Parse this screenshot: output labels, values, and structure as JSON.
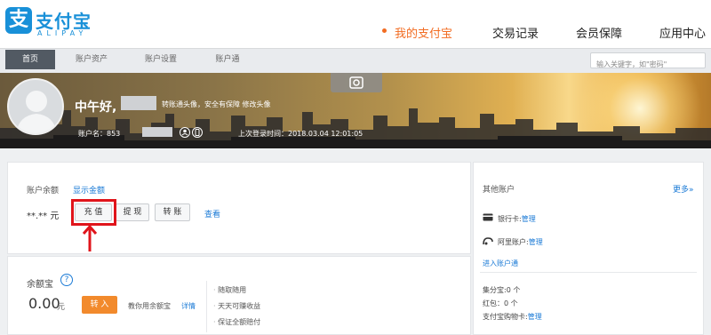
{
  "header": {
    "logo_glyph": "支",
    "logo_cn": "支付宝",
    "logo_en": "ALIPAY",
    "nav": [
      {
        "label": "我的支付宝",
        "active": true
      },
      {
        "label": "交易记录",
        "active": false
      },
      {
        "label": "会员保障",
        "active": false
      },
      {
        "label": "应用中心",
        "active": false
      }
    ],
    "accent_color": "#f26c22",
    "brand_color": "#1890d8"
  },
  "subnav": {
    "tabs": [
      {
        "label": "首页",
        "active": true
      },
      {
        "label": "账户资产",
        "active": false
      },
      {
        "label": "账户设置",
        "active": false
      },
      {
        "label": "账户通",
        "active": false
      }
    ],
    "search_placeholder": "输入关键字，如\"密码\""
  },
  "profile": {
    "greeting": "中午好,",
    "change_avatar": "转账通头像，安全有保障 修改头像",
    "account_label": "账户名：",
    "account_prefix": "853",
    "last_login": "上次登录时间：2018.03.04 12:01:05"
  },
  "balance": {
    "label": "账户余额",
    "show_link": "显示金额",
    "amount_masked": "**.** 元",
    "buttons": {
      "recharge": "充 值",
      "withdraw": "提 现",
      "transfer": "转 账"
    },
    "view_link": "查看",
    "highlight_color": "#e0141b"
  },
  "side": {
    "title": "其他账户",
    "more": "更多»",
    "bank_card_label": "银行卡:",
    "bank_card_link": "管理",
    "ali_label": "阿里账户:",
    "ali_link": "管理",
    "enter_link": "进入账户通",
    "points": "集分宝:0 个",
    "red_packet": "红包：0 个",
    "shopping_card_label": "支付宝购物卡:",
    "shopping_card_link": "管理"
  },
  "yeb": {
    "title": "余额宝",
    "help": "?",
    "amount": "0.00",
    "unit": "元",
    "transfer_in": "转 入",
    "hint": "教你用余额宝",
    "detail": "详情",
    "features": [
      "随取随用",
      "天天可赚收益",
      "保证全额赔付"
    ]
  }
}
